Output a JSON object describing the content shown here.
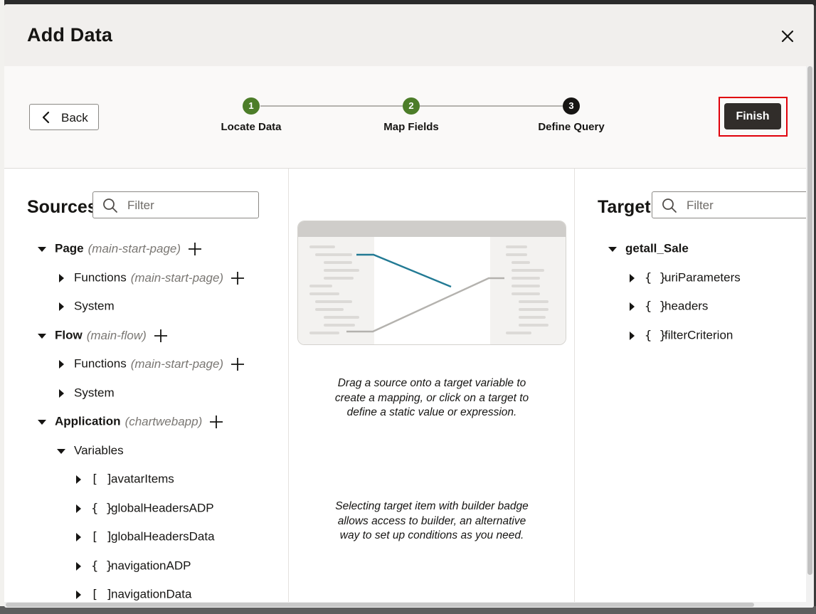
{
  "dialog": {
    "title": "Add Data",
    "close_icon": "close-icon"
  },
  "toolbar": {
    "back_label": "Back",
    "finish_label": "Finish",
    "steps": [
      {
        "number": "1",
        "label": "Locate Data",
        "state": "complete",
        "color": "#4c7d29"
      },
      {
        "number": "2",
        "label": "Map Fields",
        "state": "complete",
        "color": "#4c7d29"
      },
      {
        "number": "3",
        "label": "Define Query",
        "state": "current",
        "color": "#161513"
      }
    ]
  },
  "sources": {
    "title": "Sources",
    "filter_placeholder": "Filter",
    "items": [
      {
        "label": "Page",
        "context": "(main-start-page)",
        "icon": "caret-down-icon"
      },
      {
        "label": "Functions",
        "context": "(main-start-page)",
        "icon": "caret-right-icon"
      },
      {
        "label": "System",
        "icon": "caret-right-icon"
      },
      {
        "label": "Flow",
        "context": "(main-flow)",
        "icon": "caret-down-icon"
      },
      {
        "label": "Functions",
        "context": "(main-start-page)",
        "icon": "caret-right-icon"
      },
      {
        "label": "System",
        "icon": "caret-right-icon"
      },
      {
        "label": "Application",
        "context": "(chartwebapp)",
        "icon": "caret-down-icon"
      },
      {
        "label": "Variables",
        "icon": "caret-down-icon"
      },
      {
        "label": "avatarItems",
        "type_glyph": "[ ]",
        "icon": "caret-right-icon"
      },
      {
        "label": "globalHeadersADP",
        "type_glyph": "{ }",
        "icon": "caret-right-icon"
      },
      {
        "label": "globalHeadersData",
        "type_glyph": "[ ]",
        "icon": "caret-right-icon"
      },
      {
        "label": "navigationADP",
        "type_glyph": "{ }",
        "icon": "caret-right-icon"
      },
      {
        "label": "navigationData",
        "type_glyph": "[ ]",
        "icon": "caret-right-icon"
      }
    ]
  },
  "middle": {
    "illustration": "mapping-illustration",
    "hint_primary": "Drag a source onto a target variable to create a mapping, or click on a target to define a static value or expression.",
    "hint_secondary": "Selecting target item with builder badge allows access to builder, an alternative way to set up conditions as you need."
  },
  "target": {
    "title": "Target",
    "filter_placeholder": "Filter",
    "items": [
      {
        "label": "getall_Sale",
        "icon": "caret-down-icon"
      },
      {
        "label": "uriParameters",
        "type_glyph": "{ }",
        "icon": "caret-right-icon"
      },
      {
        "label": "headers",
        "type_glyph": "{ }",
        "icon": "caret-right-icon"
      },
      {
        "label": "filterCriterion",
        "type_glyph": "{ }",
        "icon": "caret-right-icon"
      }
    ]
  },
  "colors": {
    "accent_green": "#4c7d29",
    "finish_bg": "#312d2a",
    "highlight_red": "#e0000a",
    "mapping_line": "#227a94"
  }
}
